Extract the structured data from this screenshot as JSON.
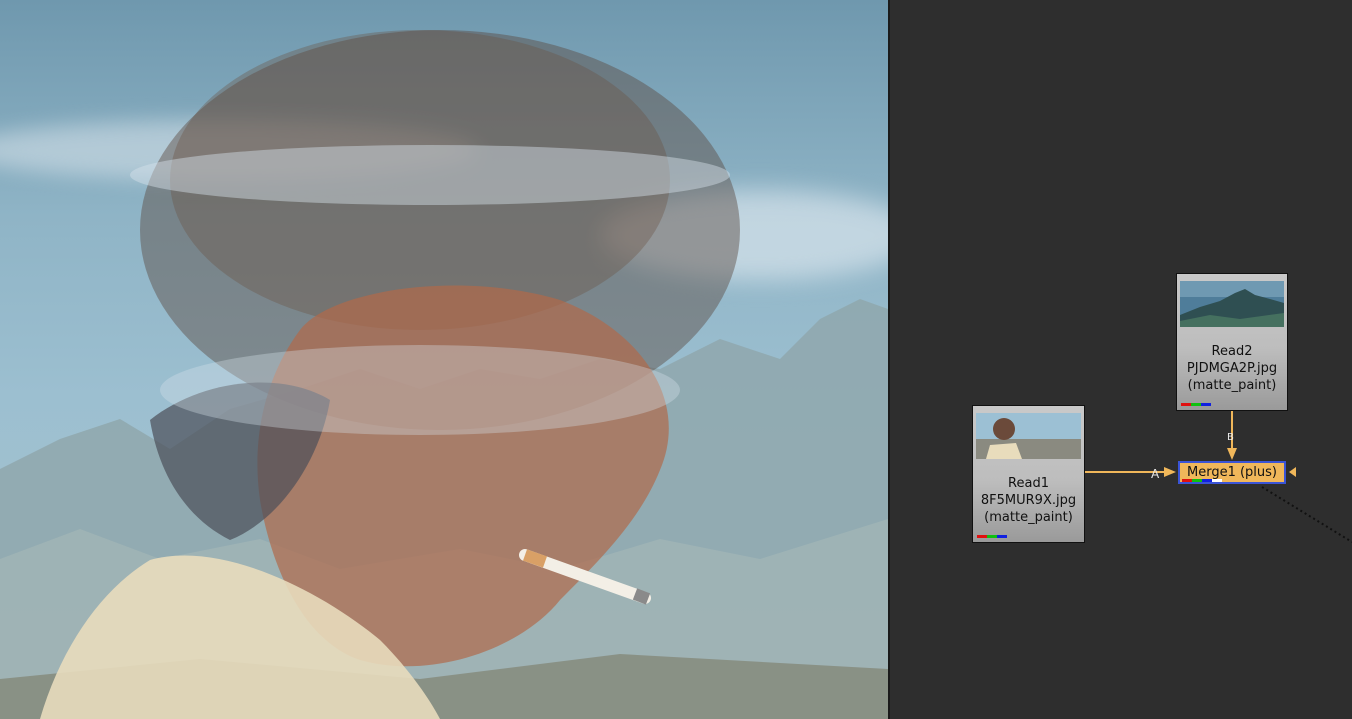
{
  "viewer": {
    "description_icon": "image-viewer"
  },
  "nodes": {
    "read1": {
      "name": "Read1",
      "file": "8F5MUR9X.jpg",
      "tag": "(matte_paint)"
    },
    "read2": {
      "name": "Read2",
      "file": "PJDMGA2P.jpg",
      "tag": "(matte_paint)"
    },
    "merge1": {
      "label": "Merge1 (plus)",
      "input_a": "A",
      "input_b": "B"
    }
  },
  "colors": {
    "node_bg": "#c0c0c0",
    "merge_bg": "#f0b75a",
    "selected_border": "#3a54d6",
    "wire": "#f0b75a",
    "graph_bg": "#2e2e2e",
    "channel_red": "#e01010",
    "channel_green": "#10c010",
    "channel_blue": "#1020e0"
  }
}
